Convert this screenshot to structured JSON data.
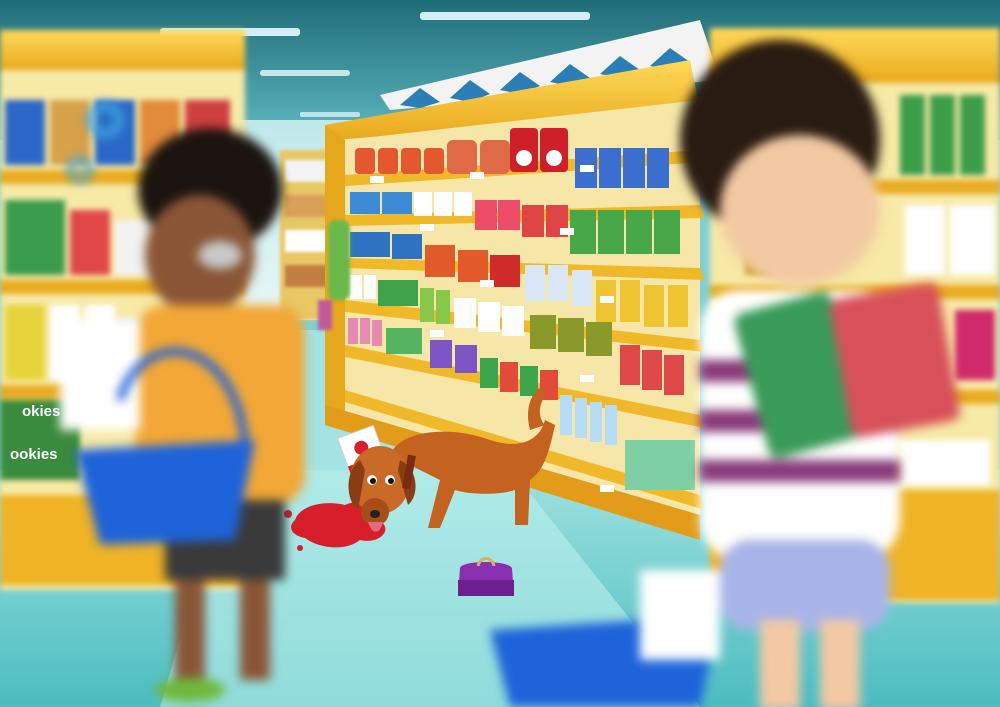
{
  "scene": {
    "description_tags": [
      "supermarket-aisle",
      "boy-with-basket",
      "girl-with-basket",
      "dog-licking-spill",
      "dropped-purse"
    ],
    "colors": {
      "ceiling": "#2f8f9a",
      "floor": "#6ccfcf",
      "shelf_yellow": "#f4c534",
      "spill_red": "#d81e2a",
      "dog_brown": "#c4621f",
      "purse_purple": "#8a2fb0",
      "basket_blue": "#1e63d9"
    }
  },
  "packaging": {
    "cookies_label_1": "okies",
    "cookies_label_2": "ookies"
  }
}
